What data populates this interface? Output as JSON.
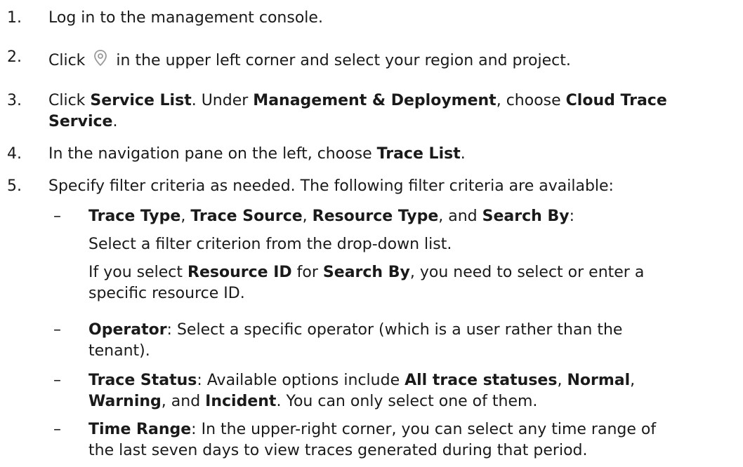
{
  "steps": [
    {
      "num": "1.",
      "text": "Log in to the management console."
    },
    {
      "num": "2.",
      "pre": "Click",
      "icon": "location-pin-icon",
      "post": "in the upper left corner and select your region and project."
    },
    {
      "num": "3.",
      "t1": "Click ",
      "b1": "Service List",
      "t2": ". Under ",
      "b2": "Management & Deployment",
      "t3": ", choose ",
      "b3a": "Cloud Trace",
      "b3b": "Service",
      "t4": "."
    },
    {
      "num": "4.",
      "t1": "In the navigation pane on the left, choose ",
      "b1": "Trace List",
      "t2": "."
    },
    {
      "num": "5.",
      "text": "Specify filter criteria as needed. The following filter criteria are available:"
    }
  ],
  "criteria": [
    {
      "dash": "–",
      "b1": "Trace Type",
      "t1": ", ",
      "b2": "Trace Source",
      "t2": ", ",
      "b3": "Resource Type",
      "t3": ", and ",
      "b4": "Search By",
      "t4": ":",
      "p1": "Select a filter criterion from the drop-down list.",
      "p2_t1": "If you select ",
      "p2_b1": "Resource ID",
      "p2_t2": " for ",
      "p2_b2": "Search By",
      "p2_t3": ", you need to select or enter a",
      "p2_line2": "specific resource ID."
    },
    {
      "dash": "–",
      "b1": "Operator",
      "t1": ": Select a specific operator (which is a user rather than the",
      "line2": "tenant)."
    },
    {
      "dash": "–",
      "b1": "Trace Status",
      "t1": ": Available options include ",
      "b2": "All trace statuses",
      "t2": ", ",
      "b3": "Normal",
      "t3": ",",
      "b4": "Warning",
      "t4": ", and ",
      "b5": "Incident",
      "t5": ". You can only select one of them."
    },
    {
      "dash": "–",
      "b1": "Time Range",
      "t1": ": In the upper-right corner, you can select any time range of",
      "line2": "the last seven days to view traces generated during that period."
    }
  ],
  "colors": {
    "text": "#1a1a1a",
    "icon": "#9a9a9a"
  }
}
